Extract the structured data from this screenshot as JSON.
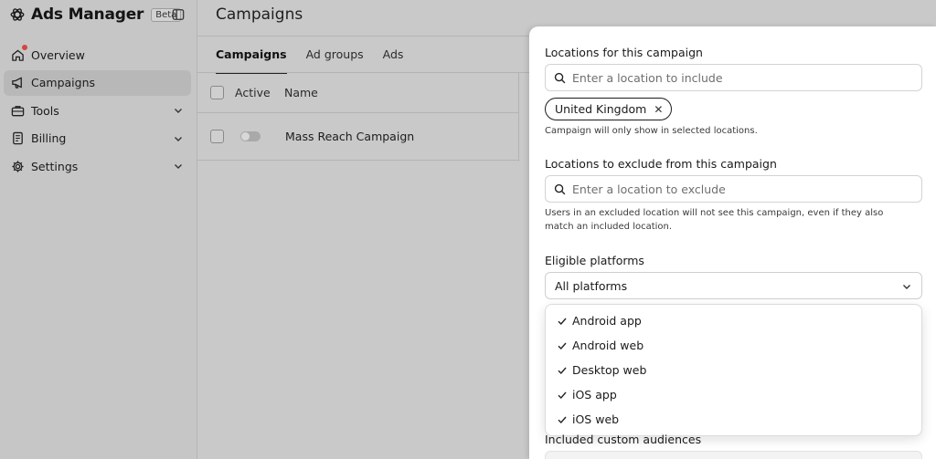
{
  "sidebar": {
    "brand": "Ads Manager",
    "badge": "Beta",
    "items": [
      {
        "label": "Overview"
      },
      {
        "label": "Campaigns"
      },
      {
        "label": "Tools"
      },
      {
        "label": "Billing"
      },
      {
        "label": "Settings"
      }
    ]
  },
  "main": {
    "title": "Campaigns",
    "tabs": [
      {
        "label": "Campaigns"
      },
      {
        "label": "Ad groups"
      },
      {
        "label": "Ads"
      }
    ],
    "table": {
      "headers": {
        "active": "Active",
        "name": "Name"
      },
      "rows": [
        {
          "name": "Mass Reach Campaign"
        }
      ]
    }
  },
  "panel": {
    "include": {
      "label": "Locations for this campaign",
      "placeholder": "Enter a location to include",
      "chip": "United Kingdom",
      "help": "Campaign will only show in selected locations."
    },
    "exclude": {
      "label": "Locations to exclude from this campaign",
      "placeholder": "Enter a location to exclude",
      "help": "Users in an excluded location will not see this campaign, even if they also match an included location."
    },
    "platforms": {
      "label": "Eligible platforms",
      "selected": "All platforms",
      "options": [
        {
          "label": "Android app"
        },
        {
          "label": "Android web"
        },
        {
          "label": "Desktop web"
        },
        {
          "label": "iOS app"
        },
        {
          "label": "iOS web"
        }
      ]
    },
    "audiences": {
      "label": "Included custom audiences"
    }
  }
}
